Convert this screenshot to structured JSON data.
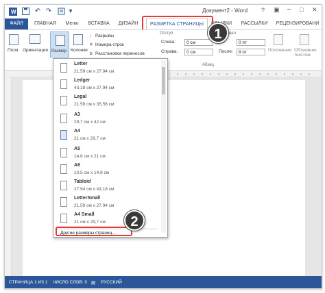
{
  "window": {
    "title": "Документ2 - Word"
  },
  "tabs": [
    {
      "label": "ФАЙЛ"
    },
    {
      "label": "ГЛАВНАЯ"
    },
    {
      "label": "Меню"
    },
    {
      "label": "ВСТАВКА"
    },
    {
      "label": "ДИЗАЙН"
    },
    {
      "label": "РАЗМЕТКА СТРАНИЦЫ"
    },
    {
      "label": "ССЫЛКИ"
    },
    {
      "label": "РАССЫЛКИ"
    },
    {
      "label": "РЕЦЕНЗИРОВАНИ"
    }
  ],
  "ribbon": {
    "fields_label": "Поля",
    "orientation_label": "Ориентация",
    "size_label": "Размер",
    "columns_label": "Колонки",
    "breaks_label": "Разрывы",
    "line_numbers_label": "Номера строк",
    "hyphenation_label": "Расстановка переносов",
    "indent_group": "Отступ",
    "spacing_group": "Интервал",
    "left_label": "Слева:",
    "right_label": "Справа:",
    "left_value": "0 см",
    "right_value": "0 см",
    "before_label": "До:",
    "after_label": "После:",
    "before_value": "0 пт",
    "after_value": "8 пт",
    "paragraph_group": "Абзац",
    "position_label": "Положение",
    "wrap_label": "Обтекание текстом"
  },
  "dropdown": {
    "items": [
      {
        "name": "Letter",
        "size": "21,59 см x 27,94 см"
      },
      {
        "name": "Ledger",
        "size": "43,18 см x 27,94 см"
      },
      {
        "name": "Legal",
        "size": "21,59 см x 35,56 см"
      },
      {
        "name": "A3",
        "size": "29,7 см x 42 см"
      },
      {
        "name": "A4",
        "size": "21 см x 29,7 см"
      },
      {
        "name": "A5",
        "size": "14,8 см x 21 см"
      },
      {
        "name": "A6",
        "size": "10,5 см x 14,8 см"
      },
      {
        "name": "Tabloid",
        "size": "27,94 см x 43,18 см"
      },
      {
        "name": "LetterSmall",
        "size": "21,59 см x 27,94 см"
      },
      {
        "name": "A4 Small",
        "size": "21 см x 29,7 см"
      }
    ],
    "more_label": "Другие размеры страниц..."
  },
  "callouts": {
    "step1": "1",
    "step2": "2"
  },
  "status": {
    "page": "СТРАНИЦА 1 ИЗ 1",
    "words": "ЧИСЛО СЛОВ: 0",
    "language": "РУССКИЙ"
  },
  "colors": {
    "accent": "#2b579a",
    "callout": "#e53935"
  }
}
